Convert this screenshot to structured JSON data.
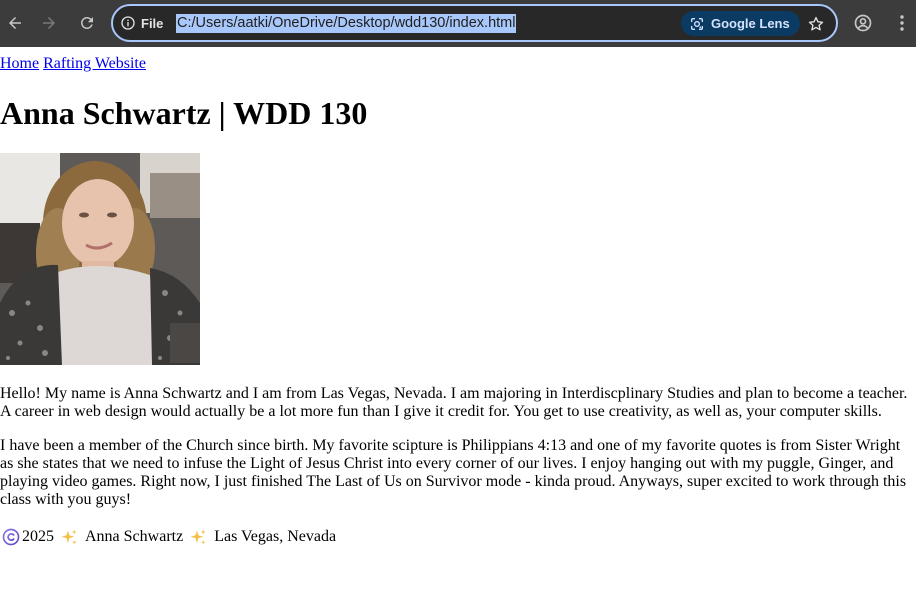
{
  "browser": {
    "site_chip_label": "File",
    "url": "C:/Users/aatki/OneDrive/Desktop/wdd130/index.html",
    "lens_label": "Google Lens",
    "icons": [
      "back-arrow-icon",
      "forward-arrow-icon",
      "reload-icon",
      "info-icon",
      "google-lens-icon",
      "bookmark-star-icon",
      "profile-icon",
      "menu-dots-icon"
    ]
  },
  "nav": {
    "links": [
      "Home",
      "Rafting Website"
    ]
  },
  "page": {
    "title": "Anna Schwartz | WDD 130",
    "photo_alt": "Anna Schwartz",
    "paragraph1": "Hello! My name is Anna Schwartz and I am from Las Vegas, Nevada. I am majoring in Interdiscplinary Studies and plan to become a teacher. A career in web design would actually be a lot more fun than I give it credit for. You get to use creativity, as well as, your computer skills.",
    "paragraph2": "I have been a member of the Church since birth. My favorite scipture is Philippians 4:13 and one of my favorite quotes is from Sister Wright as she states that we need to infuse the Light of Jesus Christ into every corner of our lives. I enjoy hanging out with my puggle, Ginger, and playing video games. Right now, I just finished The Last of Us on Survivor mode - kinda proud. Anyways, super excited to work through this class with you guys!"
  },
  "footer": {
    "year": "2025",
    "name": "Anna Schwartz",
    "location": "Las Vegas, Nevada",
    "icons": [
      "copyright-icon",
      "sparkles-icon"
    ]
  },
  "colors": {
    "toolbar_bg": "#3c3c3c",
    "omnibox_border": "#a8c7fa",
    "url_highlight": "#a8c7fa",
    "lens_bg": "#0b3a63",
    "link": "#0000ee"
  }
}
